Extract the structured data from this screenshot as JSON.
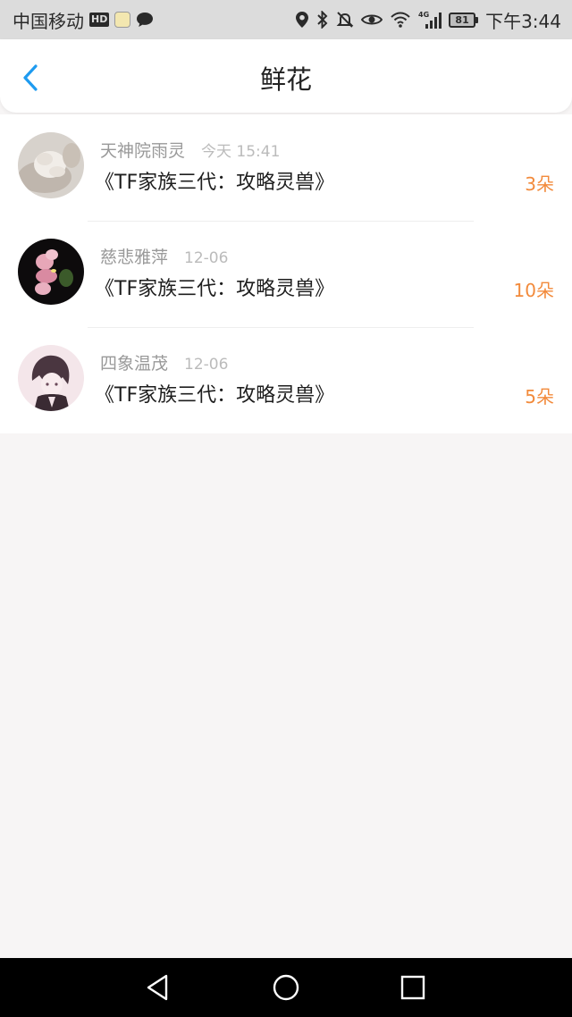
{
  "status_bar": {
    "carrier": "中国移动",
    "hd_badge": "HD",
    "battery_level": "81",
    "time": "下午3:44",
    "network_label": "4G"
  },
  "header": {
    "title": "鲜花"
  },
  "flowers": [
    {
      "user": "天神院雨灵",
      "date": "今天 15:41",
      "book": "《TF家族三代：攻略灵兽》",
      "count": "3朵"
    },
    {
      "user": "慈悲雅萍",
      "date": "12-06",
      "book": "《TF家族三代：攻略灵兽》",
      "count": "10朵"
    },
    {
      "user": "四象温茂",
      "date": "12-06",
      "book": "《TF家族三代：攻略灵兽》",
      "count": "5朵"
    }
  ],
  "colors": {
    "accent_blue": "#1e9bf0",
    "count_orange": "#f28a3b",
    "status_bar_bg": "#dcdcdc",
    "page_bg": "#f7f5f5"
  },
  "icons": {
    "back": "chevron-left-icon",
    "nav_back": "triangle-back-icon",
    "nav_home": "circle-home-icon",
    "nav_recent": "square-recent-icon"
  }
}
